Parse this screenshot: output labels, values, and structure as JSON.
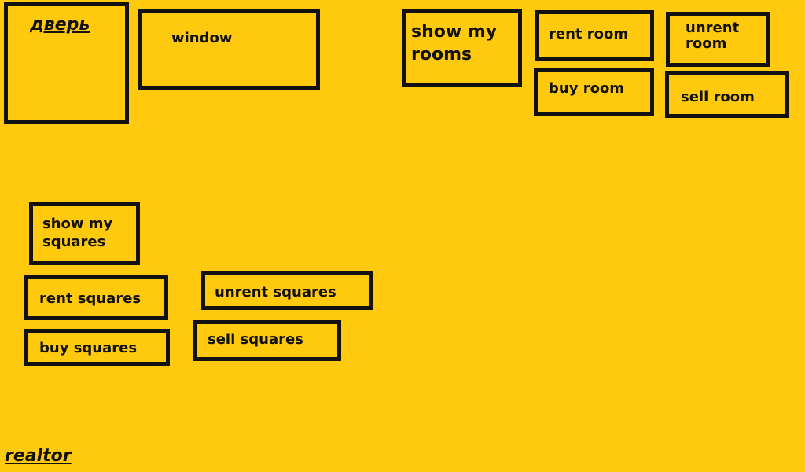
{
  "top": {
    "door_label": "дверь",
    "window_label": "window",
    "show_my_rooms_label": "show my rooms",
    "rent_room_label": "rent room",
    "unrent_room_label": "unrent room",
    "buy_room_label": "buy room",
    "sell_room_label": "sell room"
  },
  "squares": {
    "show_my_squares_label": "show my squares",
    "rent_squares_label": "rent squares",
    "unrent_squares_label": "unrent squares",
    "buy_squares_label": "buy squares",
    "sell_squares_label": "sell squares"
  },
  "footer": {
    "realtor_label": "realtor"
  },
  "colors": {
    "background": "#FFC90E",
    "border": "#111111"
  }
}
